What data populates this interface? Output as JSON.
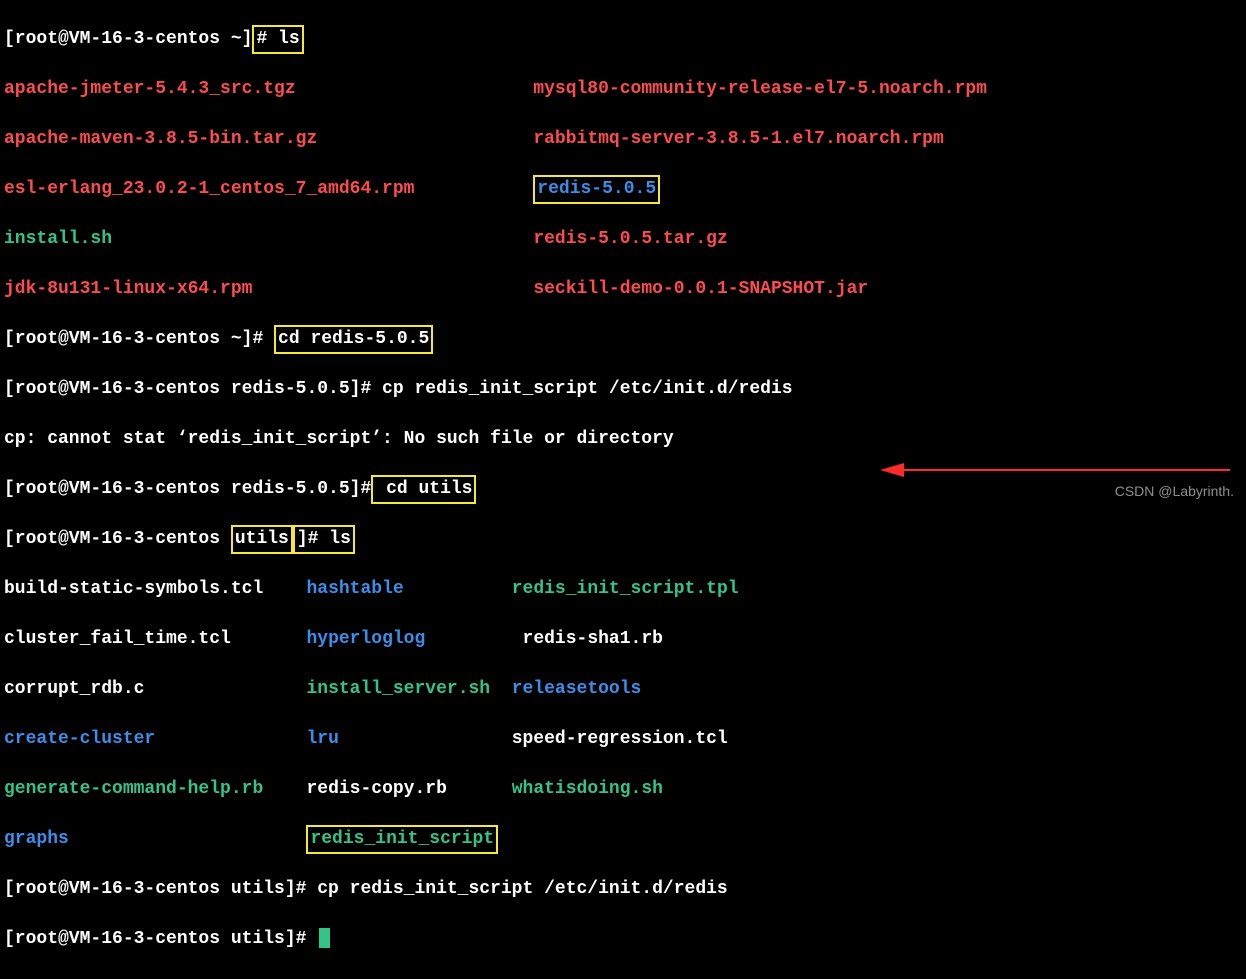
{
  "lines": {
    "l1_prompt": "[root@VM-16-3-centos ~]",
    "l1_cmd": "# ls",
    "l2a": "apache-jmeter-5.4.3_src.tgz",
    "l2b": "mysql80-community-release-el7-5.noarch.rpm",
    "l3a": "apache-maven-3.8.5-bin.tar.gz",
    "l3b": "rabbitmq-server-3.8.5-1.el7.noarch.rpm",
    "l4a": "esl-erlang_23.0.2-1_centos_7_amd64.rpm",
    "l4b": "redis-5.0.5",
    "l5a": "install.sh",
    "l5b": "redis-5.0.5.tar.gz",
    "l6a": "jdk-8u131-linux-x64.rpm",
    "l6b": "seckill-demo-0.0.1-SNAPSHOT.jar",
    "l7_prompt": "[root@VM-16-3-centos ~]# ",
    "l7_cmd": "cd redis-5.0.5",
    "l8": "[root@VM-16-3-centos redis-5.0.5]# cp redis_init_script /etc/init.d/redis",
    "l9": "cp: cannot stat ‘redis_init_script’: No such file or directory",
    "l10_a": "[root@VM-16-3-centos redis-5.0.5]#",
    "l10_b": " cd utils",
    "l11_a": "[root@VM-16-3-centos ",
    "l11_b": "utils",
    "l11_c": "]# ls",
    "l12a": "build-static-symbols.tcl",
    "l12b": "hashtable",
    "l12c": "redis_init_script.tpl",
    "l13a": "cluster_fail_time.tcl",
    "l13b": "hyperloglog",
    "l13c": "redis-sha1.rb",
    "l14a": "corrupt_rdb.c",
    "l14b": "install_server.sh",
    "l14c": "releasetools",
    "l15a": "create-cluster",
    "l15b": "lru",
    "l15c": "speed-regression.tcl",
    "l16a": "generate-command-help.rb",
    "l16b": "redis-copy.rb",
    "l16c": "whatisdoing.sh",
    "l17a": "graphs",
    "l17b": "redis_init_script",
    "l18": "[root@VM-16-3-centos utils]# cp redis_init_script /etc/init.d/redis",
    "l19": "[root@VM-16-3-centos utils]# "
  },
  "watermark": "CSDN @Labyrinth."
}
